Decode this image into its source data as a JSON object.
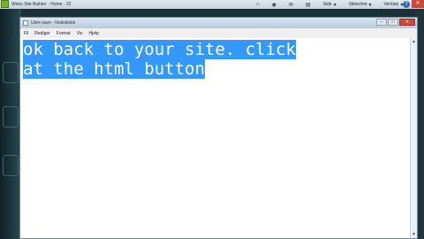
{
  "browser": {
    "title": "Webs Site Builder - Home - 22",
    "toolbar": {
      "page_label": "Side",
      "safety_label": "Sikkerhet",
      "tools_label": "Verktøy"
    },
    "help_glyph": "?",
    "close_glyph": "✕"
  },
  "notepad": {
    "title": "Uten navn - Notisblokk",
    "menu": [
      "Fil",
      "Rediger",
      "Format",
      "Vis",
      "Hjelp"
    ],
    "lines": [
      "ok back to your site. click",
      "at the html button"
    ],
    "selection_color": "#3399ff",
    "buttons": {
      "minimize": "–",
      "maximize": "□",
      "close": "✕"
    }
  }
}
